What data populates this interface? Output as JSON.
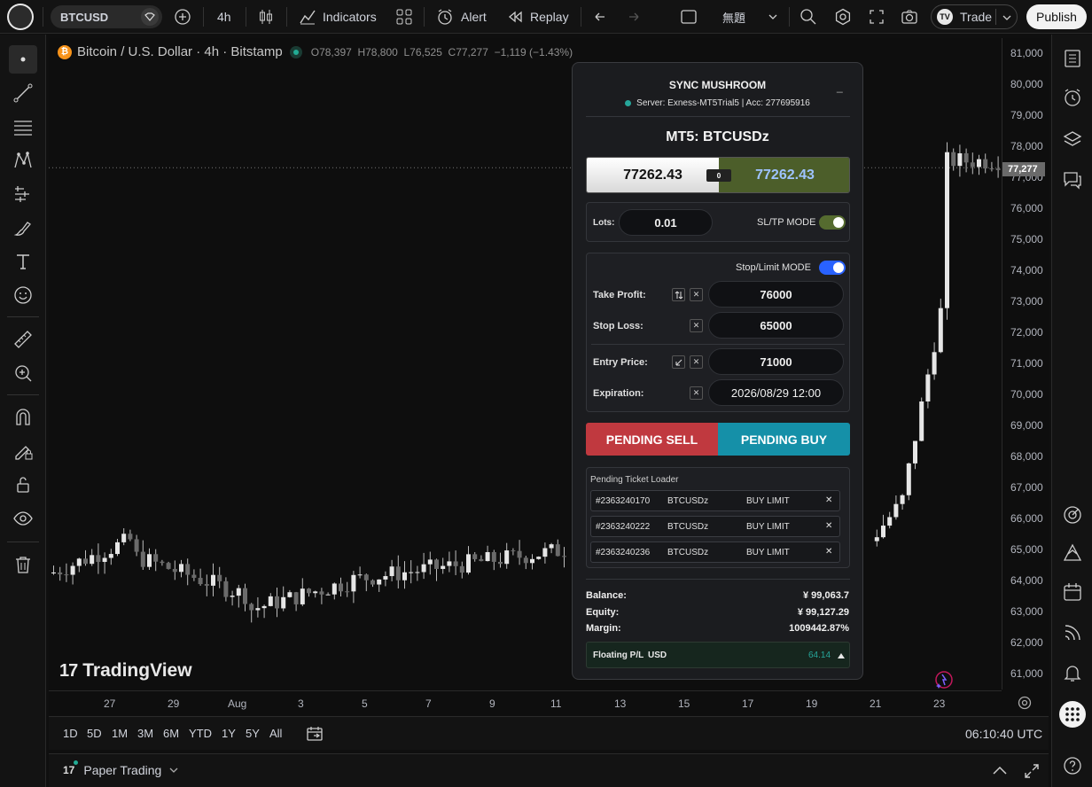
{
  "topbar": {
    "symbol": "BTCUSD",
    "interval": "4h",
    "indicators": "Indicators",
    "alert": "Alert",
    "replay": "Replay",
    "layout_name": "無題",
    "trade": "Trade",
    "publish": "Publish"
  },
  "legend": {
    "title": "Bitcoin / U.S. Dollar · 4h · Bitstamp",
    "ohlc": "O78,397  H78,800  L76,525  C77,277  −1,119 (−1.43%)"
  },
  "price_axis": {
    "labels": [
      "81,000",
      "80,000",
      "79,000",
      "78,000",
      "77,000",
      "76,000",
      "75,000",
      "74,000",
      "73,000",
      "72,000",
      "71,000",
      "70,000",
      "69,000",
      "68,000",
      "67,000",
      "66,000",
      "65,000",
      "64,000",
      "63,000",
      "62,000",
      "61,000"
    ],
    "current": "77,277"
  },
  "time_axis": {
    "labels": [
      "27",
      "29",
      "Aug",
      "3",
      "5",
      "7",
      "9",
      "11",
      "13",
      "15",
      "17",
      "19",
      "21",
      "23"
    ]
  },
  "watermark": "TradingView",
  "ranges": [
    "1D",
    "5D",
    "1M",
    "3M",
    "6M",
    "YTD",
    "1Y",
    "5Y",
    "All"
  ],
  "clock": "06:10:40 UTC",
  "bottom": {
    "paper_trading": "Paper Trading"
  },
  "panel": {
    "title": "SYNC MUSHROOM",
    "minimize": "_",
    "server": "Server: Exness-MT5Trial5 | Acc: 277695916",
    "symbol_title": "MT5: BTCUSDz",
    "bid": "77262.43",
    "spread": "0",
    "ask": "77262.43",
    "lots_label": "Lots:",
    "lots_value": "0.01",
    "sltp_label": "SL/TP MODE",
    "stoplimit_label": "Stop/Limit MODE",
    "take_profit_label": "Take Profit:",
    "take_profit_value": "76000",
    "stop_loss_label": "Stop Loss:",
    "stop_loss_value": "65000",
    "entry_label": "Entry Price:",
    "entry_value": "71000",
    "expiration_label": "Expiration:",
    "expiration_value": "2026/08/29 12:00",
    "pending_sell": "PENDING SELL",
    "pending_buy": "PENDING BUY",
    "ticket_loader_title": "Pending Ticket Loader",
    "tickets": [
      {
        "id": "#2363240170",
        "symbol": "BTCUSDz",
        "type": "BUY LIMIT"
      },
      {
        "id": "#2363240222",
        "symbol": "BTCUSDz",
        "type": "BUY LIMIT"
      },
      {
        "id": "#2363240236",
        "symbol": "BTCUSDz",
        "type": "BUY LIMIT"
      }
    ],
    "balance_label": "Balance:",
    "balance_value": "¥ 99,063.7",
    "equity_label": "Equity:",
    "equity_value": "¥ 99,127.29",
    "margin_label": "Margin:",
    "margin_value": "1009442.87%",
    "floating_label": "Floating P/L",
    "floating_currency": "USD",
    "floating_value": "64.14"
  },
  "colors": {
    "sell": "#c0393f",
    "buy": "#1590a8",
    "ask_bg": "#4c5e2a",
    "toggle_green": "#556b2f",
    "toggle_blue": "#2962ff",
    "profit_green": "#26a69a",
    "candle": "#d8d8d8"
  }
}
